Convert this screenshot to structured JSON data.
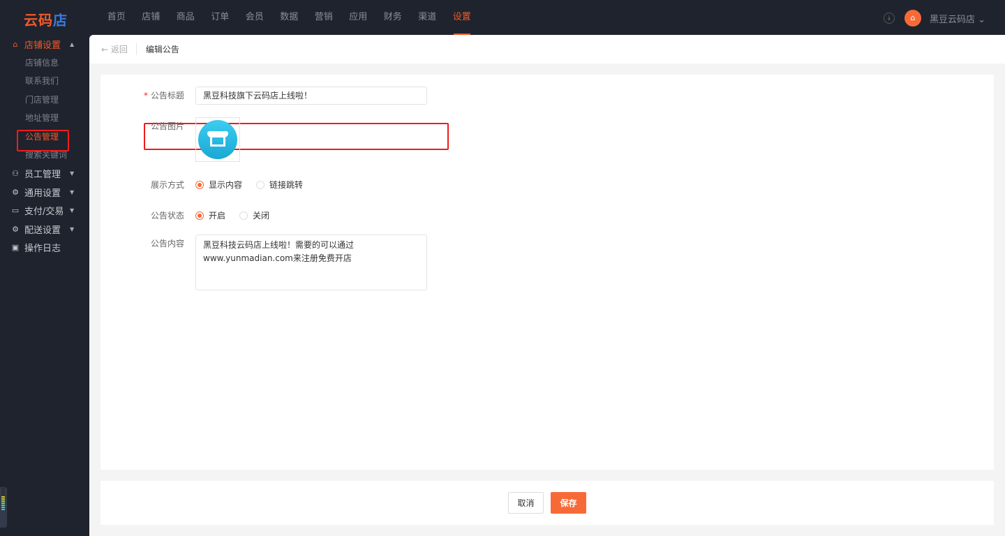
{
  "brand": {
    "logo": "云码店"
  },
  "nav": [
    "首页",
    "店铺",
    "商品",
    "订单",
    "会员",
    "数据",
    "营销",
    "应用",
    "财务",
    "渠道",
    "设置"
  ],
  "nav_active": "设置",
  "user": {
    "shop_name": "黑豆云码店"
  },
  "sidebar": {
    "group_store": "店铺设置",
    "sub": [
      "店铺信息",
      "联系我们",
      "门店管理",
      "地址管理",
      "公告管理",
      "搜索关键词"
    ],
    "groups": [
      {
        "label": "员工管理",
        "icon": "users-icon"
      },
      {
        "label": "通用设置",
        "icon": "gear-icon"
      },
      {
        "label": "支付/交易",
        "icon": "card-icon"
      },
      {
        "label": "配送设置",
        "icon": "gear-icon"
      },
      {
        "label": "操作日志",
        "icon": "log-icon"
      }
    ]
  },
  "header": {
    "back": "返回",
    "title": "编辑公告"
  },
  "form": {
    "title_label": "公告标题",
    "title_value": "黑豆科技旗下云码店上线啦！",
    "image_label": "公告图片",
    "display_label": "展示方式",
    "display_options": [
      "显示内容",
      "链接跳转"
    ],
    "status_label": "公告状态",
    "status_options": [
      "开启",
      "关闭"
    ],
    "content_label": "公告内容",
    "content_value": "黑豆科技云码店上线啦！需要的可以通过\nwww.yunmadian.com来注册免费开店"
  },
  "footer": {
    "cancel": "取消",
    "save": "保存"
  },
  "colors": {
    "accent": "#f76a37",
    "highlight": "#f01c1c"
  }
}
